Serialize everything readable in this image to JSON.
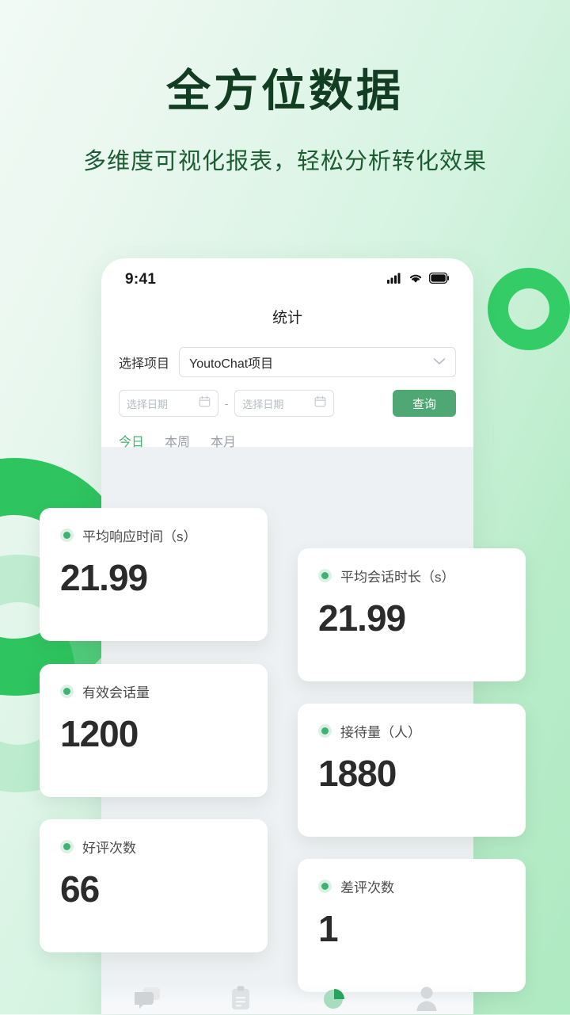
{
  "hero": {
    "headline": "全方位数据",
    "subheadline": "多维度可视化报表，轻松分析转化效果"
  },
  "colors": {
    "accent_green": "#33cc66",
    "button_green": "#4fa873",
    "tab_active": "#43b26e",
    "dot_green": "#3fb273",
    "bg_gradient_from": "#f2faf5",
    "bg_gradient_to": "#aeeac2"
  },
  "phone": {
    "status_bar": {
      "time": "9:41",
      "icons": [
        "cellular-signal-icon",
        "wifi-icon",
        "battery-icon"
      ]
    },
    "nav_title": "统计",
    "form": {
      "project_label": "选择项目",
      "project_value": "YoutoChat项目",
      "project_chevron_icon": "chevron-down-icon",
      "date_start_placeholder": "选择日期",
      "date_end_placeholder": "选择日期",
      "date_separator": "-",
      "date_icon": "calendar-icon",
      "query_button": "查询"
    },
    "range_tabs": [
      {
        "label": "今日",
        "active": true
      },
      {
        "label": "本周",
        "active": false
      },
      {
        "label": "本月",
        "active": false
      }
    ],
    "stat_cards": [
      {
        "label": "平均响应时间（s）",
        "value": "21.99"
      },
      {
        "label": "平均会话时长（s）",
        "value": "21.99"
      },
      {
        "label": "有效会话量",
        "value": "1200"
      },
      {
        "label": "接待量（人）",
        "value": "1880"
      },
      {
        "label": "好评次数",
        "value": "66"
      },
      {
        "label": "差评次数",
        "value": "1"
      }
    ],
    "bottom_nav": [
      {
        "icon": "chat-bubbles-icon",
        "active": false
      },
      {
        "icon": "clipboard-icon",
        "active": false
      },
      {
        "icon": "pie-chart-icon",
        "active": true
      },
      {
        "icon": "person-icon",
        "active": false
      }
    ]
  }
}
